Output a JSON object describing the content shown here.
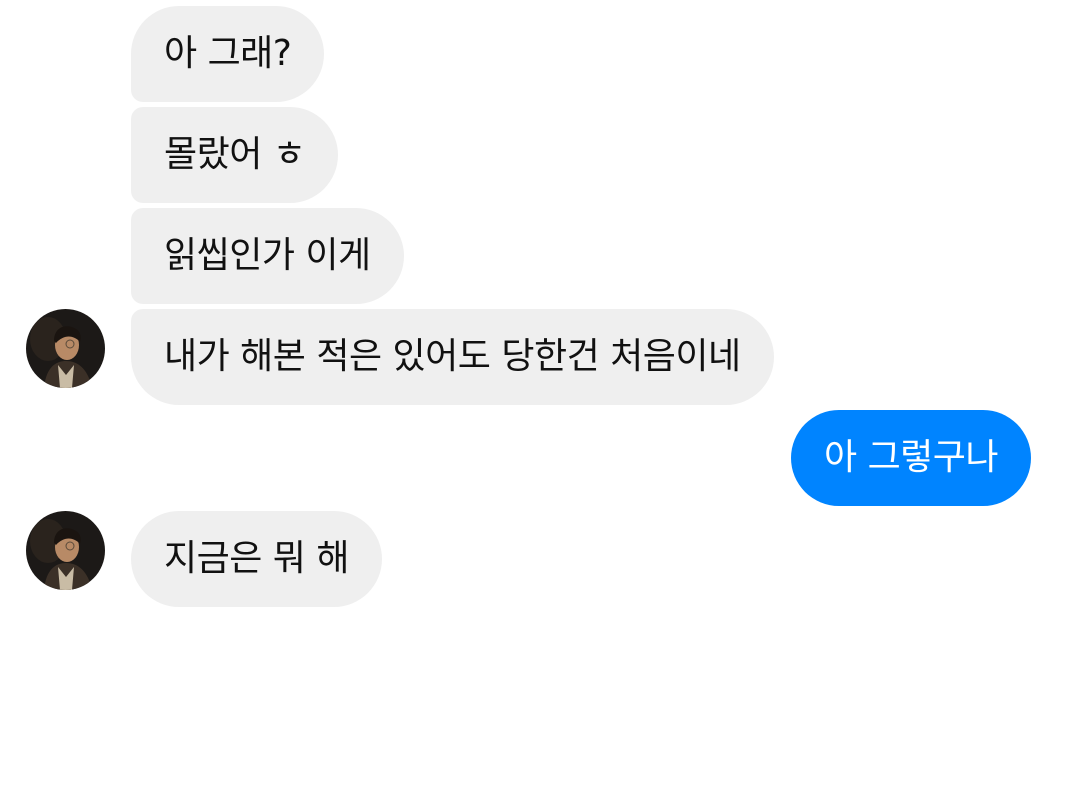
{
  "conversation": {
    "messages": [
      {
        "sender": "contact",
        "text": "아 그래?"
      },
      {
        "sender": "contact",
        "text": "몰랐어 ㅎ"
      },
      {
        "sender": "contact",
        "text": "읽씹인가 이게"
      },
      {
        "sender": "contact",
        "text": "내가 해본 적은 있어도 당한건 처음이네"
      },
      {
        "sender": "me",
        "text": "아 그렇구나"
      },
      {
        "sender": "contact",
        "text": "지금은 뭐 해"
      }
    ]
  },
  "colors": {
    "incoming_bubble": "#efefef",
    "incoming_text": "#111111",
    "outgoing_bubble": "#0084ff",
    "outgoing_text": "#ffffff",
    "background": "#ffffff"
  },
  "icons": {
    "avatar": "contact-avatar-photo"
  }
}
